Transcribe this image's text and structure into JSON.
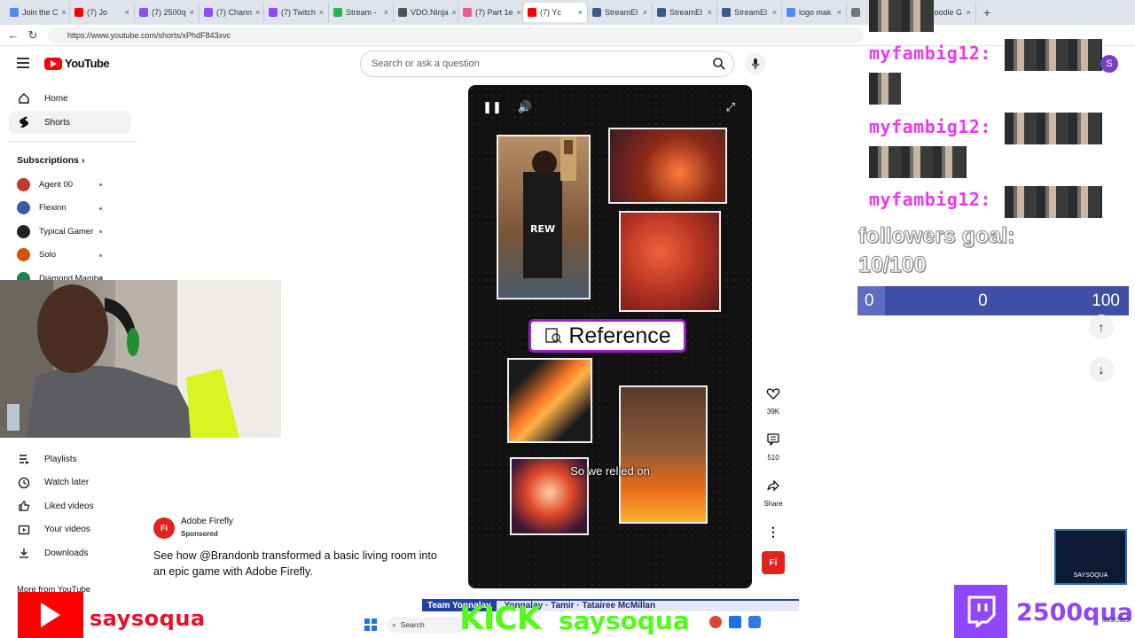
{
  "browser": {
    "tabs": [
      {
        "label": "Join the C",
        "color": "#4c8bf5"
      },
      {
        "label": "(7) Jo",
        "color": "#ff0000"
      },
      {
        "label": "(7) 2500q",
        "color": "#9146ff"
      },
      {
        "label": "(7) Chann",
        "color": "#9146ff"
      },
      {
        "label": "(7) Twitch",
        "color": "#9146ff"
      },
      {
        "label": "Stream -",
        "color": "#2bb34b"
      },
      {
        "label": "VDO.Ninja",
        "color": "#555555"
      },
      {
        "label": "(7) Part 1e",
        "color": "#e85d8a"
      },
      {
        "label": "(7) Yc",
        "color": "#ff0000"
      },
      {
        "label": "StreamEl",
        "color": "#3a5a8c"
      },
      {
        "label": "StreamEl",
        "color": "#3a5a8c"
      },
      {
        "label": "StreamEl",
        "color": "#3a5a8c"
      },
      {
        "label": "logo mak",
        "color": "#4c8bf5"
      },
      {
        "label": "",
        "color": "#777777"
      },
      {
        "label": "Hoodie G",
        "color": "#888888"
      }
    ],
    "url": "https://www.youtube.com/shorts/xPhdF843xvc"
  },
  "youtube": {
    "logo_text": "YouTube",
    "search_placeholder": "Search or ask a question",
    "nav": [
      {
        "label": "Home",
        "icon": "home-icon"
      },
      {
        "label": "Shorts",
        "icon": "shorts-icon"
      }
    ],
    "subscriptions_title": "Subscriptions",
    "subscriptions": [
      {
        "label": "Agent 00",
        "color": "#c0392b"
      },
      {
        "label": "Flexinn",
        "color": "#3b5ba9"
      },
      {
        "label": "Typical Gamer",
        "color": "#222222"
      },
      {
        "label": "Solo",
        "color": "#d35400"
      },
      {
        "label": "Diamond Mamba",
        "color": "#1e8449"
      }
    ],
    "you_items": [
      {
        "label": "Playlists",
        "icon": "playlist-icon"
      },
      {
        "label": "Watch later",
        "icon": "clock-icon"
      },
      {
        "label": "Liked videos",
        "icon": "thumbs-up-icon"
      },
      {
        "label": "Your videos",
        "icon": "video-icon"
      },
      {
        "label": "Downloads",
        "icon": "download-icon"
      }
    ],
    "more_from_youtube": "More from YouTube"
  },
  "ad": {
    "logo": "Fi",
    "name": "Adobe Firefly",
    "sponsored": "Sponsored",
    "description": "See how @Brandonb transformed a basic living room into an epic game with Adobe Firefly."
  },
  "short": {
    "reference_label": "Reference",
    "caption": "So we relied on",
    "actions": {
      "like_count": "39K",
      "comment_count": "510",
      "share_label": "Share"
    },
    "fi_logo": "Fi"
  },
  "stream": {
    "chat": [
      {
        "user": "myfambig12",
        "sep": ":"
      },
      {
        "user": "myfambig12",
        "sep": ":"
      },
      {
        "user": "myfambig12",
        "sep": ":"
      }
    ],
    "goal_title": "followers goal:",
    "goal_value": "10/100",
    "goal_progress": 0.1,
    "goal_bar": {
      "left": "0",
      "mid": "0",
      "right": "100"
    },
    "avatar_letter": "S",
    "badge_text": "SAYSOQUA",
    "youtube_name": "saysoqua",
    "kick_label": "KICK",
    "kick_name": "saysoqua",
    "twitch_count": "2500qua",
    "team_bar_title": "Team Yonnalay",
    "team_bar_text": "Yonnalay · Tamir · Tatairee McMillan",
    "taskbar_search": "Search",
    "tray_date": "8/23/2026"
  },
  "colors": {
    "youtube_red": "#ff0000",
    "chat_pink": "#ec38f0",
    "goal_blue": "#3e4fa8",
    "kick_green": "#53fc18",
    "twitch_purple": "#9146ff",
    "reference_border": "#9b1ec2"
  }
}
